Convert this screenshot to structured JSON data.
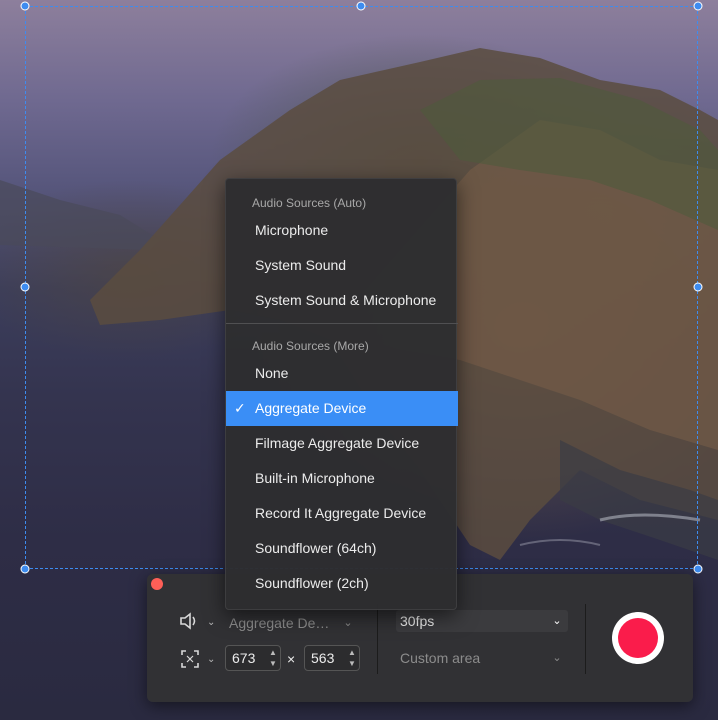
{
  "menu": {
    "header_auto": "Audio Sources (Auto)",
    "items_auto": [
      "Microphone",
      "System Sound",
      "System Sound & Microphone"
    ],
    "header_more": "Audio Sources (More)",
    "items_more": [
      "None",
      "Aggregate Device",
      "Filmage Aggregate Device",
      "Built-in Microphone",
      "Record It Aggregate Device",
      "Soundflower (64ch)",
      "Soundflower (2ch)"
    ],
    "selected": "Aggregate Device"
  },
  "toolbar": {
    "audio_source_value": "Aggregate De…",
    "width_value": "673",
    "height_value": "563",
    "times_sign": "×",
    "fps_value": "30fps",
    "area_value": "Custom area"
  },
  "icons": {
    "speaker": "speaker-icon",
    "area": "crop-area-icon",
    "record": "record-icon",
    "check": "checkmark-icon"
  },
  "colors": {
    "accent": "#3a8ef6",
    "record": "#fa1c4b",
    "close": "#fe5f57",
    "selection": "#3d8cf0"
  }
}
